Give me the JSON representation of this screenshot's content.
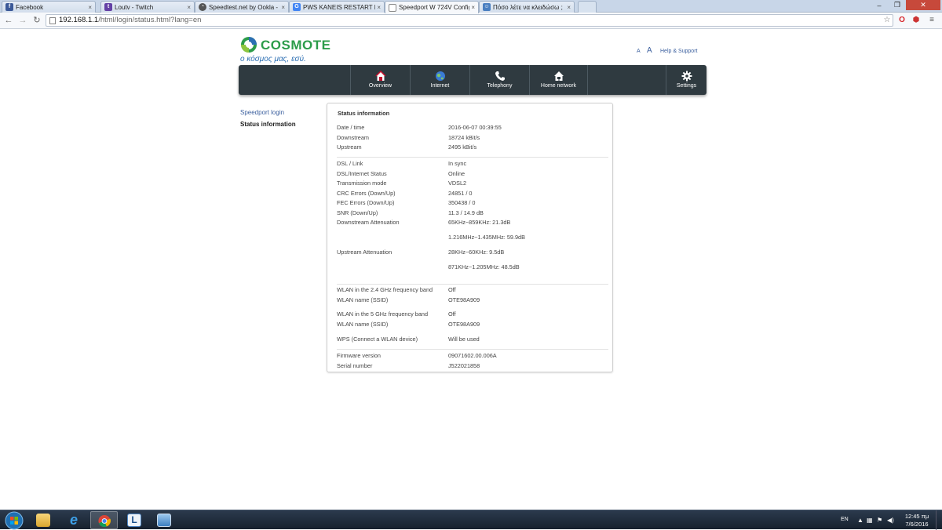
{
  "browser": {
    "tabs": [
      {
        "title": "Facebook",
        "icon": "facebook-icon",
        "color": "#3b5998",
        "active": false
      },
      {
        "title": "Loutv - Twitch",
        "icon": "twitch-icon",
        "color": "#6441a5",
        "active": false
      },
      {
        "title": "Speedtest.net by Ookla - T",
        "icon": "speedtest-icon",
        "color": "#555555",
        "active": false
      },
      {
        "title": "PWS KANEIS RESTART ME",
        "icon": "google-icon",
        "color": "#4285f4",
        "active": false
      },
      {
        "title": "Speedport W 724V Config",
        "icon": "page-icon",
        "color": "#888888",
        "active": true
      },
      {
        "title": "Πόσο λέτε να κλειδώσω ;",
        "icon": "forum-icon",
        "color": "#4a7fc1",
        "active": false
      }
    ],
    "url_host": "192.168.1.1",
    "url_path": "/html/login/status.html?lang=en"
  },
  "header": {
    "brand": "COSMOTE",
    "tagline": "ο κόσμος μας, εσύ.",
    "font_small": "A",
    "font_large": "A",
    "help_link": "Help & Support"
  },
  "mainnav": [
    {
      "label": "Overview",
      "icon": "home-icon"
    },
    {
      "label": "Internet",
      "icon": "globe-icon"
    },
    {
      "label": "Telephony",
      "icon": "phone-icon"
    },
    {
      "label": "Home network",
      "icon": "house-network-icon"
    },
    {
      "label": "Settings",
      "icon": "gear-icon"
    }
  ],
  "sidenav": {
    "login": "Speedport login",
    "status": "Status information"
  },
  "panel": {
    "title": "Status information",
    "rows": [
      {
        "label": "Date / time",
        "value": "2016-06-07 00:39:55"
      },
      {
        "label": "Downstream",
        "value": "18724 kBit/s"
      },
      {
        "label": "Upstream",
        "value": "2495 kBit/s"
      },
      {
        "label": "DSL / Link",
        "value": "In sync"
      },
      {
        "label": "DSL/Internet Status",
        "value": "Online"
      },
      {
        "label": "Transmission mode",
        "value": "VDSL2"
      },
      {
        "label": "CRC Errors (Down/Up)",
        "value": "24851 / 0"
      },
      {
        "label": "FEC Errors (Down/Up)",
        "value": "350438 / 0"
      },
      {
        "label": "SNR (Down/Up)",
        "value": "11.3 / 14.9 dB"
      },
      {
        "label": "Downstream Attenuation",
        "value": "65KHz~859KHz: 21.3dB"
      },
      {
        "label": "",
        "value": "1.216MHz~1.435MHz: 59.9dB"
      },
      {
        "label": "Upstream Attenuation",
        "value": "28KHz~60KHz: 9.5dB"
      },
      {
        "label": "",
        "value": "871KHz~1.205MHz: 48.5dB"
      },
      {
        "label": "WLAN in the 2.4 GHz frequency band",
        "value": "Off"
      },
      {
        "label": "WLAN name (SSID)",
        "value": "OTE98A909"
      },
      {
        "label": "WLAN in the 5 GHz frequency band",
        "value": "Off"
      },
      {
        "label": "WLAN name (SSID)",
        "value": "OTE98A909"
      },
      {
        "label": "WPS (Connect a WLAN device)",
        "value": "Will be used"
      },
      {
        "label": "Firmware version",
        "value": "09071602.00.006A"
      },
      {
        "label": "Serial number",
        "value": "J522021858"
      }
    ]
  },
  "taskbar": {
    "language": "EN",
    "time": "12:45 πμ",
    "date": "7/6/2016"
  }
}
